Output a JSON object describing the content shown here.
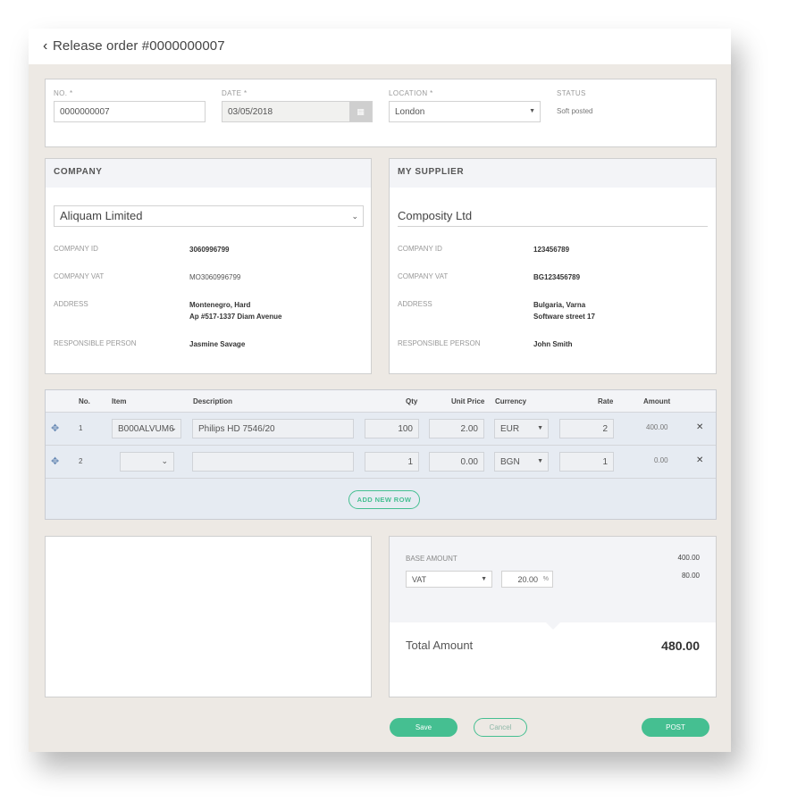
{
  "header": {
    "title": "Release order #0000000007"
  },
  "order": {
    "no_label": "NO. *",
    "no_value": "0000000007",
    "date_label": "DATE *",
    "date_value": "03/05/2018",
    "location_label": "LOCATION *",
    "location_value": "London",
    "status_label": "STATUS",
    "status_value": "Soft posted"
  },
  "company": {
    "heading": "COMPANY",
    "name": "Aliquam Limited",
    "id_label": "COMPANY ID",
    "id_value": "3060996799",
    "vat_label": "COMPANY VAT",
    "vat_value": "MO3060996799",
    "address_label": "ADDRESS",
    "address_line1": "Montenegro, Hard",
    "address_line2": "Ap #517-1337 Diam Avenue",
    "person_label": "RESPONSIBLE PERSON",
    "person_value": "Jasmine Savage"
  },
  "supplier": {
    "heading": "MY SUPPLIER",
    "name": "Composity Ltd",
    "id_label": "COMPANY ID",
    "id_value": "123456789",
    "vat_label": "COMPANY VAT",
    "vat_value": "BG123456789",
    "address_label": "ADDRESS",
    "address_line1": "Bulgaria, Varna",
    "address_line2": "Software street 17",
    "person_label": "RESPONSIBLE PERSON",
    "person_value": "John Smith"
  },
  "items": {
    "columns": {
      "no": "No.",
      "item": "Item",
      "description": "Description",
      "qty": "Qty",
      "unit_price": "Unit Price",
      "currency": "Currency",
      "rate": "Rate",
      "amount": "Amount"
    },
    "rows": [
      {
        "no": "1",
        "item": "B000ALVUM6",
        "description": "Philips HD 7546/20",
        "qty": "100",
        "unit_price": "2.00",
        "currency": "EUR",
        "rate": "2",
        "amount": "400.00"
      },
      {
        "no": "2",
        "item": "",
        "description": "",
        "qty": "1",
        "unit_price": "0.00",
        "currency": "BGN",
        "rate": "1",
        "amount": "0.00"
      }
    ],
    "add_row_label": "ADD NEW ROW"
  },
  "totals": {
    "base_label": "BASE AMOUNT",
    "base_value": "400.00",
    "vat_select": "VAT",
    "vat_rate": "20.00",
    "vat_unit": "%",
    "vat_value": "80.00",
    "total_label": "Total Amount",
    "total_value": "480.00"
  },
  "actions": {
    "save": "Save",
    "cancel": "Cancel",
    "post": "POST"
  },
  "colors": {
    "accent": "#45bf91",
    "background": "#ede9e4"
  }
}
